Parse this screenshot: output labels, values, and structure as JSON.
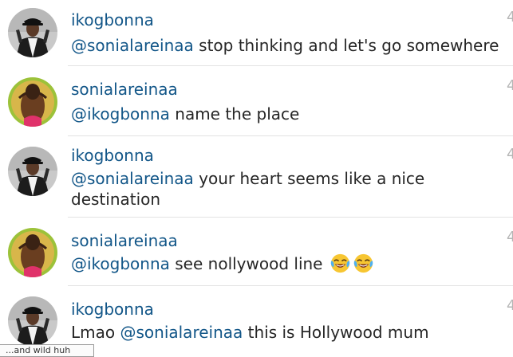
{
  "comments": [
    {
      "username": "ikogbonna",
      "mention": "@sonialareinaa",
      "body": " stop thinking and let's go somewhere",
      "time": "4"
    },
    {
      "username": "sonialareinaa",
      "mention": "@ikogbonna",
      "body": " name the place",
      "time": "4"
    },
    {
      "username": "ikogbonna",
      "mention": "@sonialareinaa",
      "body": " your heart seems like a nice destination",
      "time": "4"
    },
    {
      "username": "sonialareinaa",
      "mention": "@ikogbonna",
      "body": " see nollywood line",
      "emoji": "tears-of-joy",
      "time": "4"
    },
    {
      "username": "ikogbonna",
      "prefix": "Lmao ",
      "mention": "@sonialareinaa",
      "body": " this is Hollywood mum",
      "time": "4"
    }
  ],
  "tooltip": {
    "text": "...and wild huh"
  },
  "colors": {
    "username": "#125688",
    "text": "#262626",
    "timestamp": "#b4b4b4",
    "divider": "#e2e2e2"
  }
}
